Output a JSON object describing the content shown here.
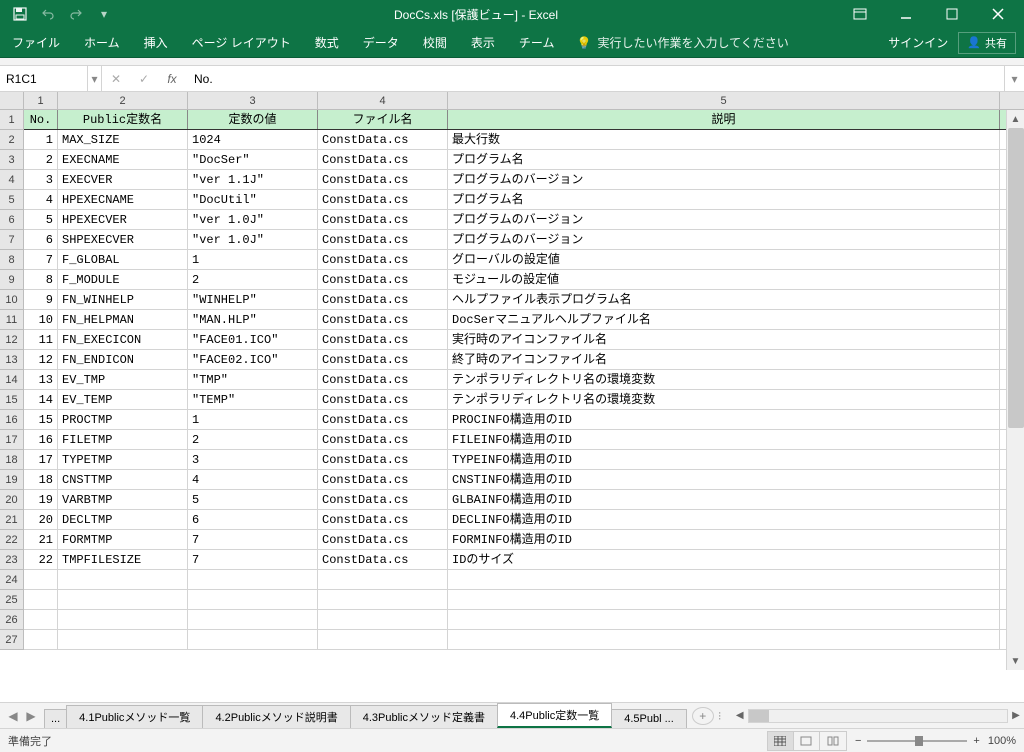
{
  "title": "DocCs.xls  [保護ビュー] - Excel",
  "qat": {
    "save": "save",
    "undo": "undo",
    "redo": "redo"
  },
  "ribbon": {
    "tabs": [
      "ファイル",
      "ホーム",
      "挿入",
      "ページ レイアウト",
      "数式",
      "データ",
      "校閲",
      "表示",
      "チーム"
    ],
    "tellme": "実行したい作業を入力してください",
    "signin": "サインイン",
    "share": "共有"
  },
  "formula": {
    "nameBox": "R1C1",
    "value": "No."
  },
  "columns": [
    "1",
    "2",
    "3",
    "4",
    "5"
  ],
  "headers": {
    "c1": "No.",
    "c2": "Public定数名",
    "c3": "定数の値",
    "c4": "ファイル名",
    "c5": "説明"
  },
  "rows": [
    {
      "n": "1",
      "name": "MAX_SIZE",
      "val": "1024",
      "file": "ConstData.cs",
      "desc": "最大行数"
    },
    {
      "n": "2",
      "name": "EXECNAME",
      "val": "\"DocSer\"",
      "file": "ConstData.cs",
      "desc": "プログラム名"
    },
    {
      "n": "3",
      "name": "EXECVER",
      "val": "\"ver 1.1J\"",
      "file": "ConstData.cs",
      "desc": "プログラムのバージョン"
    },
    {
      "n": "4",
      "name": "HPEXECNAME",
      "val": "\"DocUtil\"",
      "file": "ConstData.cs",
      "desc": "プログラム名"
    },
    {
      "n": "5",
      "name": "HPEXECVER",
      "val": "\"ver 1.0J\"",
      "file": "ConstData.cs",
      "desc": "プログラムのバージョン"
    },
    {
      "n": "6",
      "name": "SHPEXECVER",
      "val": "\"ver 1.0J\"",
      "file": "ConstData.cs",
      "desc": "プログラムのバージョン"
    },
    {
      "n": "7",
      "name": "F_GLOBAL",
      "val": "1",
      "file": "ConstData.cs",
      "desc": "グローバルの設定値"
    },
    {
      "n": "8",
      "name": "F_MODULE",
      "val": "2",
      "file": "ConstData.cs",
      "desc": "モジュールの設定値"
    },
    {
      "n": "9",
      "name": "FN_WINHELP",
      "val": "\"WINHELP\"",
      "file": "ConstData.cs",
      "desc": "ヘルプファイル表示プログラム名"
    },
    {
      "n": "10",
      "name": "FN_HELPMAN",
      "val": "\"MAN.HLP\"",
      "file": "ConstData.cs",
      "desc": "DocSerマニュアルヘルプファイル名"
    },
    {
      "n": "11",
      "name": "FN_EXECICON",
      "val": "\"FACE01.ICO\"",
      "file": "ConstData.cs",
      "desc": "実行時のアイコンファイル名"
    },
    {
      "n": "12",
      "name": "FN_ENDICON",
      "val": "\"FACE02.ICO\"",
      "file": "ConstData.cs",
      "desc": "終了時のアイコンファイル名"
    },
    {
      "n": "13",
      "name": "EV_TMP",
      "val": "\"TMP\"",
      "file": "ConstData.cs",
      "desc": "テンポラリディレクトリ名の環境変数"
    },
    {
      "n": "14",
      "name": "EV_TEMP",
      "val": "\"TEMP\"",
      "file": "ConstData.cs",
      "desc": "テンポラリディレクトリ名の環境変数"
    },
    {
      "n": "15",
      "name": "PROCTMP",
      "val": "1",
      "file": "ConstData.cs",
      "desc": "PROCINFO構造用のID"
    },
    {
      "n": "16",
      "name": "FILETMP",
      "val": "2",
      "file": "ConstData.cs",
      "desc": "FILEINFO構造用のID"
    },
    {
      "n": "17",
      "name": "TYPETMP",
      "val": "3",
      "file": "ConstData.cs",
      "desc": "TYPEINFO構造用のID"
    },
    {
      "n": "18",
      "name": "CNSTTMP",
      "val": "4",
      "file": "ConstData.cs",
      "desc": "CNSTINFO構造用のID"
    },
    {
      "n": "19",
      "name": "VARBTMP",
      "val": "5",
      "file": "ConstData.cs",
      "desc": "GLBAINFO構造用のID"
    },
    {
      "n": "20",
      "name": "DECLTMP",
      "val": "6",
      "file": "ConstData.cs",
      "desc": "DECLINFO構造用のID"
    },
    {
      "n": "21",
      "name": "FORMTMP",
      "val": "7",
      "file": "ConstData.cs",
      "desc": "FORMINFO構造用のID"
    },
    {
      "n": "22",
      "name": "TMPFILESIZE",
      "val": "7",
      "file": "ConstData.cs",
      "desc": "IDのサイズ"
    }
  ],
  "blankRows": [
    "24",
    "25",
    "26",
    "27"
  ],
  "sheetTabs": {
    "ellipsis": "...",
    "items": [
      "4.1Publicメソッド一覧",
      "4.2Publicメソッド説明書",
      "4.3Publicメソッド定義書",
      "4.4Public定数一覧",
      "4.5Publ ..."
    ],
    "active": 3
  },
  "status": {
    "ready": "準備完了",
    "zoom": "100%"
  }
}
